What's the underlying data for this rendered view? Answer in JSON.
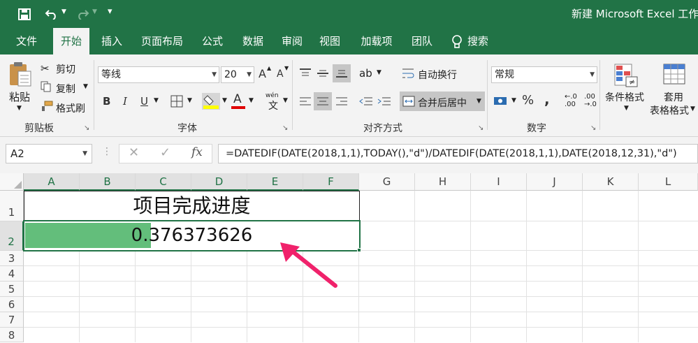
{
  "title_bar": {
    "title": "新建 Microsoft Excel 工作"
  },
  "tabs": [
    "文件",
    "开始",
    "插入",
    "页面布局",
    "公式",
    "数据",
    "审阅",
    "视图",
    "加载项",
    "团队",
    "搜索"
  ],
  "ribbon": {
    "clipboard": {
      "paste": "粘贴",
      "cut": "剪切",
      "copy": "复制",
      "format_painter": "格式刷",
      "group_title": "剪贴板"
    },
    "font": {
      "font_name": "等线",
      "font_size": "20",
      "bold": "B",
      "italic": "I",
      "underline": "U",
      "grow": "A",
      "shrink": "A",
      "font_color": "A",
      "phonetic": "wén",
      "group_title": "字体"
    },
    "alignment": {
      "wrap_text": "自动换行",
      "merge_center": "合并后居中",
      "group_title": "对齐方式"
    },
    "number": {
      "format": "常规",
      "percent": "%",
      "comma": ",",
      "inc_decimal": ".00",
      "dec_decimal": ".0",
      "group_title": "数字"
    },
    "styles": {
      "conditional": "条件格式",
      "table_format_1": "套用",
      "table_format_2": "表格格式"
    }
  },
  "formula_bar": {
    "name_box": "A2",
    "fx": "fx",
    "formula": "=DATEDIF(DATE(2018,1,1),TODAY(),\"d\")/DATEDIF(DATE(2018,1,1),DATE(2018,12,31),\"d\")"
  },
  "sheet": {
    "columns": [
      "A",
      "B",
      "C",
      "D",
      "E",
      "F",
      "G",
      "H",
      "I",
      "J",
      "K",
      "L"
    ],
    "rows": [
      "1",
      "2",
      "3",
      "4",
      "5",
      "6",
      "7",
      "8"
    ],
    "title_cell": "项目完成进度",
    "value_cell": "0.376373626",
    "progress_fraction": 0.376373626,
    "progress_color": "#63be7b",
    "arrow_color": "#f0226b"
  },
  "colors": {
    "brand": "#217346"
  }
}
